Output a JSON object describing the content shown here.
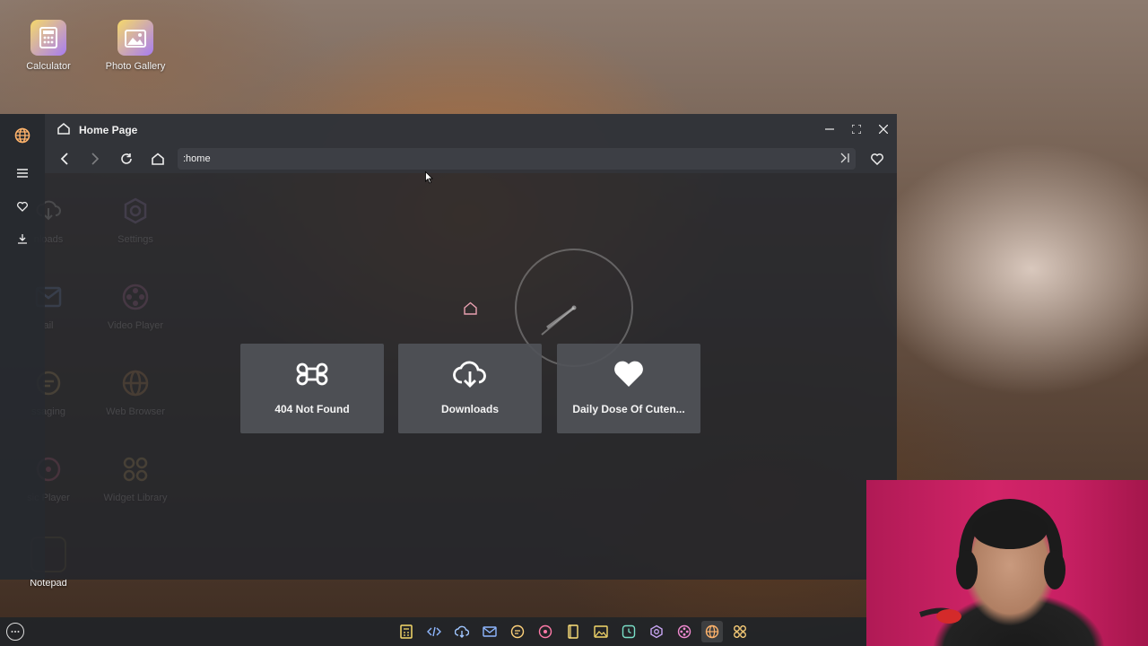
{
  "desktop": {
    "icons": [
      {
        "label": "Calculator",
        "icon": "calculator-icon"
      },
      {
        "label": "Photo Gallery",
        "icon": "photo-gallery-icon"
      },
      {
        "label": "Notepad",
        "icon": "notepad-icon"
      }
    ],
    "behind_icons": [
      {
        "label": "nloads",
        "icon": "downloads-icon"
      },
      {
        "label": "Settings",
        "icon": "settings-icon"
      },
      {
        "label": "ail",
        "icon": "mail-icon"
      },
      {
        "label": "Video Player",
        "icon": "video-player-icon"
      },
      {
        "label": "ssaging",
        "icon": "messaging-icon"
      },
      {
        "label": "Web Browser",
        "icon": "web-browser-icon"
      },
      {
        "label": "sic Player",
        "icon": "music-player-icon"
      },
      {
        "label": "Widget Library",
        "icon": "widget-library-icon"
      }
    ]
  },
  "browser": {
    "title": "Home Page",
    "address": ":home",
    "sidebar": [
      "globe-icon",
      "menu-icon",
      "heart-icon",
      "download-icon"
    ],
    "tiles": [
      {
        "label": "404 Not Found",
        "icon": "command-icon"
      },
      {
        "label": "Downloads",
        "icon": "cloud-download-icon"
      },
      {
        "label": "Daily Dose Of Cuten...",
        "icon": "heart-filled-icon"
      }
    ],
    "accent": "#e8a0b0"
  },
  "taskbar": {
    "apps": [
      "calculator-icon",
      "code-icon",
      "cloud-icon",
      "mail-icon",
      "messaging-icon",
      "music-player-icon",
      "notepad-icon",
      "photo-gallery-icon",
      "clock-icon",
      "settings-icon",
      "video-player-icon",
      "web-browser-icon",
      "widget-library-icon"
    ]
  }
}
